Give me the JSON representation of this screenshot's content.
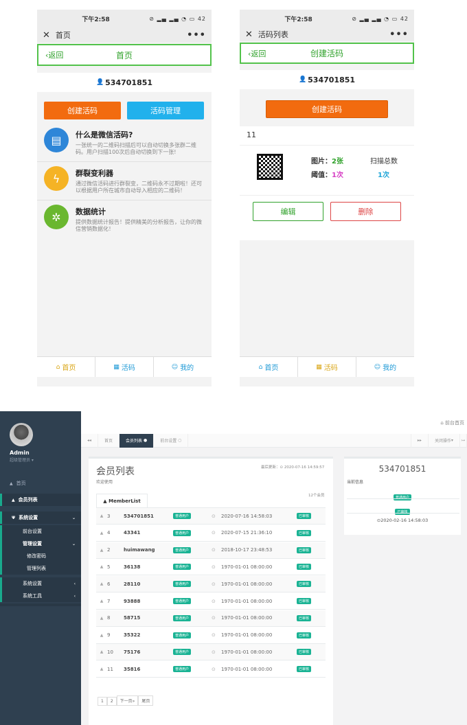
{
  "phone1": {
    "status_time": "下午2:58",
    "status_right": "42",
    "window_title": "首页",
    "nav_back": "返回",
    "nav_title": "首页",
    "user_id": "534701851",
    "btn_create": "创建活码",
    "btn_manage": "活码管理",
    "features": [
      {
        "title": "什么是微信活码?",
        "desc": "一张统一的二维码扫描后可以自动切换多张群二维码。用户扫描100次后自动切换到下一张!",
        "color": "#2e86d8"
      },
      {
        "title": "群裂变利器",
        "desc": "通过微信活码进行群裂变，二维码永不过期啦！还可以根据用户所在城市自动导入相应的二维码！",
        "color": "#f5b325"
      },
      {
        "title": "数据统计",
        "desc": "提供数据统计报告！提供精美的分析报告，让你的微信营销数据化！",
        "color": "#6ab72f"
      }
    ],
    "tabs": [
      "首页",
      "活码",
      "我的"
    ]
  },
  "phone2": {
    "status_time": "下午2:58",
    "status_right": "42",
    "window_title": "活码列表",
    "nav_back": "返回",
    "nav_title": "创建活码",
    "user_id": "534701851",
    "btn_create": "创建活码",
    "item_name": "11",
    "img_label": "图片：",
    "img_value": "2张",
    "threshold_label": "阈值：",
    "threshold_value": "1次",
    "scan_label": "扫描总数",
    "scan_value": "1次",
    "btn_edit": "编辑",
    "btn_delete": "删除",
    "tabs": [
      "首页",
      "活码",
      "我的"
    ]
  },
  "admin": {
    "user_name": "Admin",
    "user_role": "超级管理员",
    "menu": [
      {
        "label": "首页"
      },
      {
        "label": "会员列表"
      },
      {
        "label": "系统设置"
      },
      {
        "label": "前台设置"
      },
      {
        "label": "管理设置"
      },
      {
        "label": "修改密码"
      },
      {
        "label": "管理列表"
      },
      {
        "label": "系统设置"
      },
      {
        "label": "系统工具"
      }
    ],
    "topbar_link": "前台首页",
    "content_tabs": [
      "首页",
      "会员列表",
      "前台设置"
    ],
    "close_ops": "关闭操作",
    "page_title": "会员列表",
    "welcome": "欢迎使用",
    "last_update": "最后更新：⊙ 2020-07-16 14:59:57",
    "list_tab": "MemberList",
    "member_count": "12个会员",
    "rows": [
      {
        "idx": "3",
        "name": "534701851",
        "type": "普通用户",
        "time": "2020-07-16 14:58:03",
        "status": "已审核"
      },
      {
        "idx": "4",
        "name": "43341",
        "type": "普通用户",
        "time": "2020-07-15 21:36:10",
        "status": "已审核"
      },
      {
        "idx": "2",
        "name": "huimawang",
        "type": "普通用户",
        "time": "2018-10-17 23:48:53",
        "status": "已审核"
      },
      {
        "idx": "5",
        "name": "36138",
        "type": "普通用户",
        "time": "1970-01-01 08:00:00",
        "status": "已审核"
      },
      {
        "idx": "6",
        "name": "28110",
        "type": "普通用户",
        "time": "1970-01-01 08:00:00",
        "status": "已审核"
      },
      {
        "idx": "7",
        "name": "93888",
        "type": "普通用户",
        "time": "1970-01-01 08:00:00",
        "status": "已审核"
      },
      {
        "idx": "8",
        "name": "58715",
        "type": "普通用户",
        "time": "1970-01-01 08:00:00",
        "status": "已审核"
      },
      {
        "idx": "9",
        "name": "35322",
        "type": "普通用户",
        "time": "1970-01-01 08:00:00",
        "status": "已审核"
      },
      {
        "idx": "10",
        "name": "75176",
        "type": "普通用户",
        "time": "1970-01-01 08:00:00",
        "status": "已审核"
      },
      {
        "idx": "11",
        "name": "35816",
        "type": "普通用户",
        "time": "1970-01-01 08:00:00",
        "status": "已审核"
      }
    ],
    "pagination": [
      "1",
      "2",
      "下一页»",
      "尾页"
    ],
    "detail_id": "534701851",
    "detail_label": "当前信息",
    "detail_type": "普通用户",
    "detail_status": "已审核",
    "detail_time": "2020-02-16 14:58:03"
  }
}
